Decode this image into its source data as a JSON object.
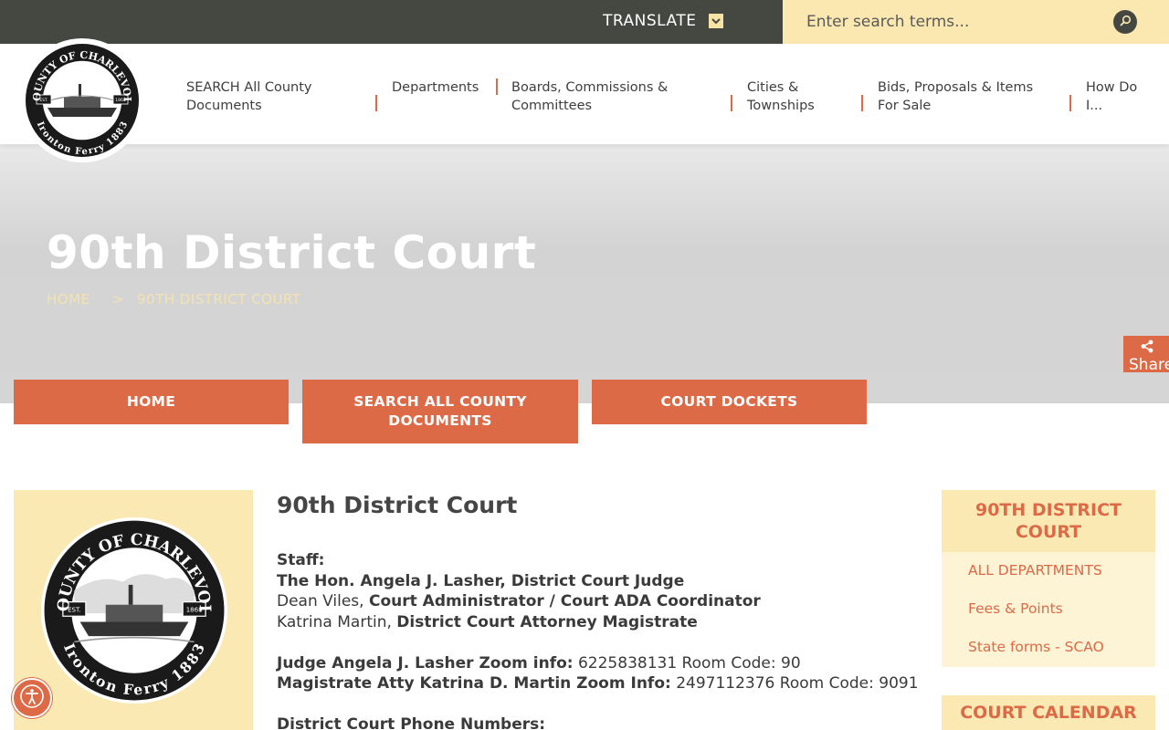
{
  "topbar": {
    "translate_label": "TRANSLATE",
    "search_placeholder": "Enter search terms..."
  },
  "logo": {
    "top_text": "COUNTY OF CHARLEVOIX",
    "bottom_text": "Ironton Ferry 1883",
    "left_badge": "EST.",
    "right_badge": "1868"
  },
  "nav": {
    "items": [
      {
        "line1": "SEARCH All County",
        "line2": "Documents"
      },
      {
        "line1": "Departments",
        "line2": ""
      },
      {
        "line1": "Boards, Commissions &",
        "line2": "Committees"
      },
      {
        "line1": "Cities &",
        "line2": "Townships"
      },
      {
        "line1": "Bids, Proposals & Items",
        "line2": "For Sale"
      },
      {
        "line1": "How Do",
        "line2": "I..."
      }
    ]
  },
  "hero": {
    "title": "90th District Court",
    "breadcrumb_home": "HOME",
    "breadcrumb_sep": ">",
    "breadcrumb_current": "90TH DISTRICT COURT"
  },
  "share": {
    "label": "Share"
  },
  "quick_links": [
    {
      "line1": "HOME",
      "line2": ""
    },
    {
      "line1": "SEARCH ALL COUNTY",
      "line2": "DOCUMENTS"
    },
    {
      "line1": "COURT DOCKETS",
      "line2": ""
    }
  ],
  "content": {
    "title": "90th District Court",
    "staff_label": "Staff:",
    "judge": "The Hon. Angela J. Lasher, District Court Judge",
    "admin_name": "Dean Viles,",
    "admin_role": "Court Administrator / Court ADA Coordinator",
    "magistrate_name": "Katrina Martin,",
    "magistrate_role": "District Court Attorney Magistrate",
    "zoom1_label": "Judge Angela J. Lasher Zoom info:",
    "zoom1_value": "6225838131 Room Code: 90",
    "zoom2_label": "Magistrate Atty Katrina D. Martin Zoom Info:",
    "zoom2_value": "2497112376 Room Code: 9091",
    "phones_label": "District Court Phone Numbers:"
  },
  "sidebar": {
    "heading_line1": "90TH DISTRICT",
    "heading_line2": "COURT",
    "links": [
      "ALL DEPARTMENTS",
      "Fees & Points",
      "State forms - SCAO"
    ],
    "calendar_heading": "COURT CALENDAR"
  },
  "colors": {
    "accent": "#dd6a47",
    "topbar": "#454841",
    "cream": "#fbe9b3",
    "hero_gray": "#d3d3d3"
  }
}
